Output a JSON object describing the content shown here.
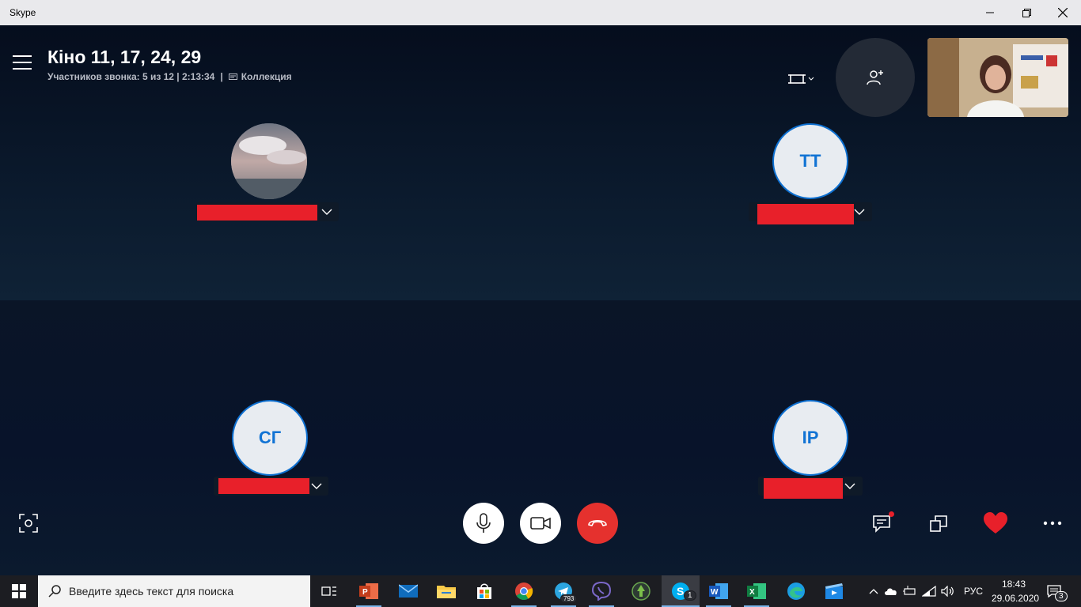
{
  "window": {
    "title": "Skype"
  },
  "call": {
    "title": "Кіно 11, 17, 24, 29",
    "participants_text": "Участников звонка: 5 из 12 | 2:13:34",
    "gallery_label": "Коллекция"
  },
  "participants": [
    {
      "initials": "",
      "has_photo": true,
      "name_redacted": true
    },
    {
      "initials": "ТТ",
      "has_photo": false,
      "name_redacted": true
    },
    {
      "initials": "СГ",
      "has_photo": false,
      "name_redacted": true
    },
    {
      "initials": "ІР",
      "has_photo": false,
      "name_redacted": true
    }
  ],
  "controls": {
    "mic": "microphone-icon",
    "video": "video-camera-icon",
    "hangup": "hang-up-icon",
    "snapshot": "snapshot-icon",
    "chat": "chat-icon",
    "share": "share-screen-icon",
    "react": "heart-icon",
    "more": "more-options-icon"
  },
  "taskbar": {
    "search_placeholder": "Введите здесь текст для поиска",
    "apps": [
      {
        "name": "task-view"
      },
      {
        "name": "powerpoint"
      },
      {
        "name": "mail"
      },
      {
        "name": "file-explorer"
      },
      {
        "name": "microsoft-store"
      },
      {
        "name": "chrome"
      },
      {
        "name": "telegram",
        "badge": "793"
      },
      {
        "name": "viber"
      },
      {
        "name": "app-green"
      },
      {
        "name": "skype",
        "badge": "1"
      },
      {
        "name": "word"
      },
      {
        "name": "excel"
      },
      {
        "name": "edge"
      },
      {
        "name": "movie-maker"
      }
    ],
    "language": "РУС",
    "time": "18:43",
    "date": "29.06.2020",
    "notifications_count": "3"
  },
  "colors": {
    "accent_blue": "#1173d4",
    "hangup_red": "#e5312e",
    "redaction_red": "#e8202a",
    "call_background": "#0a1426"
  }
}
